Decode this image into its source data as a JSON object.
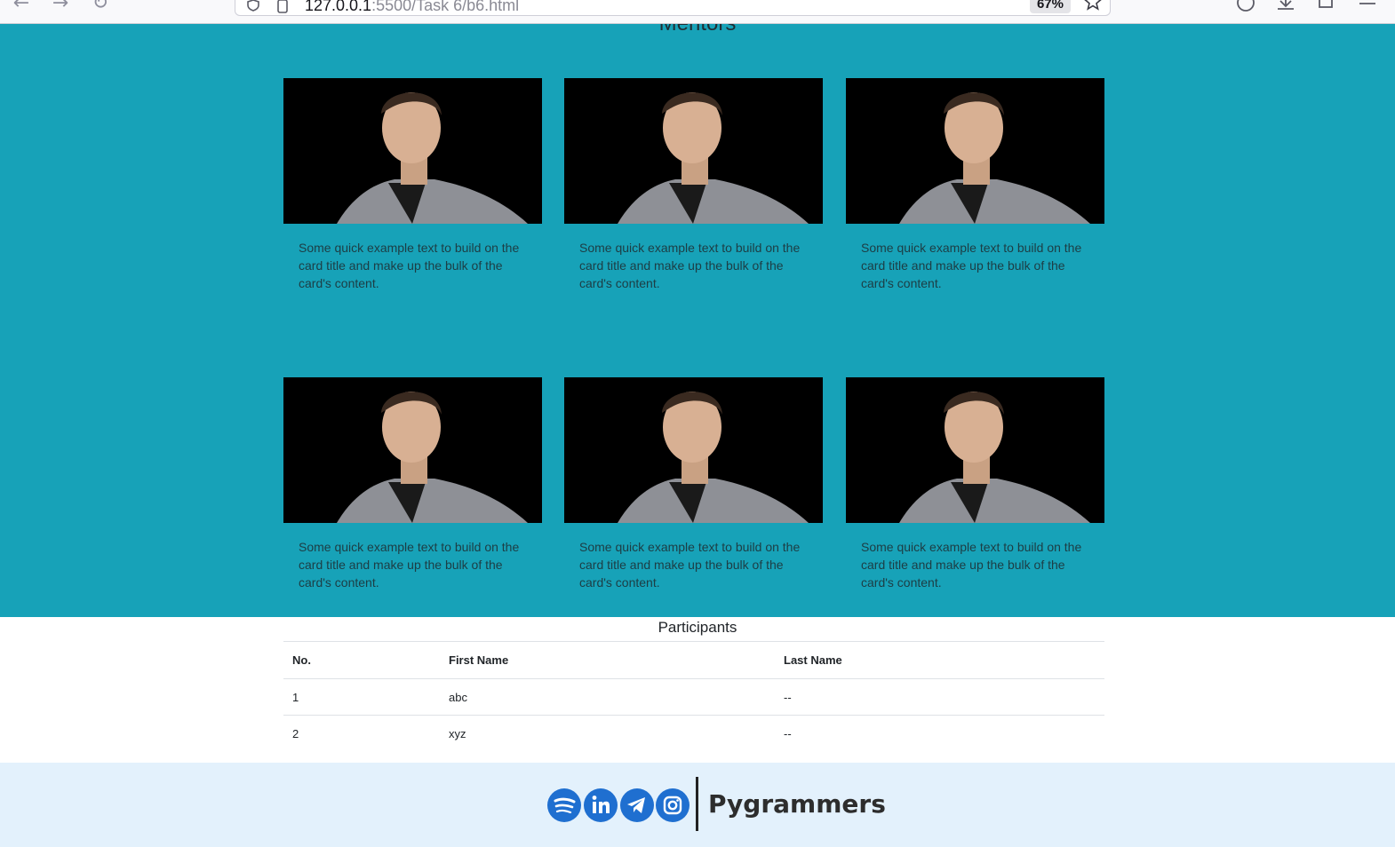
{
  "browser": {
    "url_host": "127.0.0.1",
    "url_rest": ":5500/Task 6/b6.html",
    "zoom": "67%"
  },
  "mentors": {
    "title": "Mentors",
    "card_text": "Some quick example text to build on the card title and make up the bulk of the card's content.",
    "cards": [
      {
        "text": "Some quick example text to build on the card title and make up the bulk of the card's content."
      },
      {
        "text": "Some quick example text to build on the card title and make up the bulk of the card's content."
      },
      {
        "text": "Some quick example text to build on the card title and make up the bulk of the card's content."
      },
      {
        "text": "Some quick example text to build on the card title and make up the bulk of the card's content."
      },
      {
        "text": "Some quick example text to build on the card title and make up the bulk of the card's content."
      },
      {
        "text": "Some quick example text to build on the card title and make up the bulk of the card's content."
      }
    ]
  },
  "participants": {
    "title": "Participants",
    "columns": [
      "No.",
      "First Name",
      "Last Name"
    ],
    "rows": [
      [
        "1",
        "abc",
        "--"
      ],
      [
        "2",
        "xyz",
        "--"
      ]
    ]
  },
  "footer": {
    "brand": "Pygrammers",
    "social_icons": [
      "spotify-icon",
      "linkedin-icon",
      "telegram-icon",
      "instagram-icon"
    ]
  },
  "colors": {
    "mentors_bg": "#17a2b8",
    "footer_bg": "#e3f1fc",
    "social_blue": "#1f6fd0"
  }
}
